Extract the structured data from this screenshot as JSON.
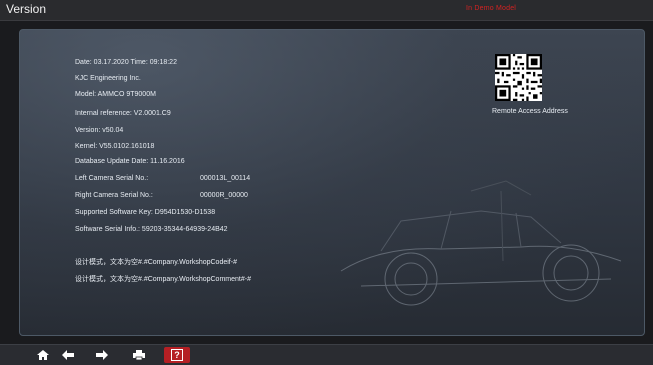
{
  "window": {
    "title": "Version",
    "mode_label": "In Demo Model"
  },
  "info": {
    "date_time": "Date: 03.17.2020  Time: 09:18:22",
    "company": "KJC Engineering Inc.",
    "model": "Model: AMMCO 9T9000M",
    "internal_reference": "Internal reference: V2.0001.C9",
    "version": "Version: v50.04",
    "kernel": "Kernel: V55.0102.161018",
    "db_update": "Database Update Date: 11.16.2016",
    "left_camera_label": "Left Camera Serial No.:",
    "left_camera_value": "000013L_00114",
    "right_camera_label": "Right Camera Serial No.:",
    "right_camera_value": "00000R_00000",
    "supported_key": "Supported Software Key: D954D1530-D1538",
    "serial_info": "Software Serial Info.: 59203-35344-64939-24B42",
    "workshop_codeif": "设计模式，文本为空#.#Company.WorkshopCodeif-#",
    "workshop_comment": "设计模式，文本为空#.#Company.WorkshopComment#-#"
  },
  "qr": {
    "label": "Remote Access Address"
  },
  "toolbar": {
    "home_icon": "home-icon",
    "back_icon": "arrow-left-icon",
    "forward_icon": "arrow-right-icon",
    "print_icon": "printer-icon",
    "help_icon": "help-icon"
  },
  "colors": {
    "accent_red": "#b51f24",
    "mode_red": "#d42222"
  }
}
